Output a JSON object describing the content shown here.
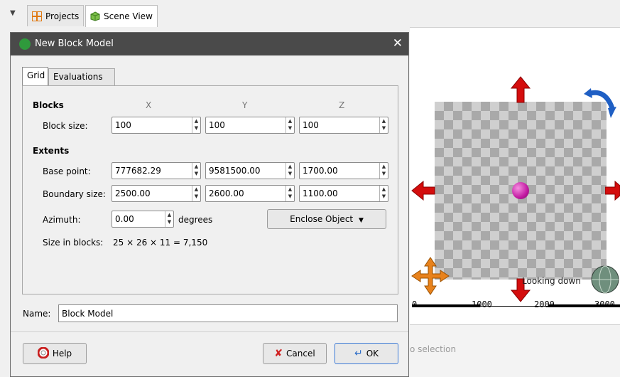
{
  "tabs": [
    {
      "label": "Projects",
      "icon": "projects-icon"
    },
    {
      "label": "Scene View",
      "icon": "scene-view-icon"
    }
  ],
  "scene": {
    "looking_label": "Looking down",
    "scale_labels": [
      "0",
      "1000",
      "2000",
      "3000"
    ],
    "no_selection": "o selection"
  },
  "dialog": {
    "title": "New Block Model",
    "close_glyph": "✕",
    "tabs": [
      "Grid",
      "Evaluations"
    ],
    "blocks_heading": "Blocks",
    "columns": [
      "X",
      "Y",
      "Z"
    ],
    "block_size_label": "Block size:",
    "block_size": [
      "100",
      "100",
      "100"
    ],
    "extents_heading": "Extents",
    "base_point_label": "Base point:",
    "base_point": [
      "777682.29",
      "9581500.00",
      "1700.00"
    ],
    "boundary_size_label": "Boundary size:",
    "boundary_size": [
      "2500.00",
      "2600.00",
      "1100.00"
    ],
    "azimuth_label": "Azimuth:",
    "azimuth_value": "0.00",
    "azimuth_unit": "degrees",
    "enclose_label": "Enclose Object",
    "size_in_blocks_label": "Size in blocks:",
    "size_in_blocks_value": "25 × 26 × 11 = 7,150",
    "name_label": "Name:",
    "name_value": "Block Model",
    "help_label": "Help",
    "cancel_label": "Cancel",
    "ok_label": "OK"
  },
  "colors": {
    "titlebar": "#4a4a4a",
    "arrow_red": "#d40d0d",
    "gizmo_orange": "#e8821c",
    "rotate_blue": "#1f5fc4"
  }
}
